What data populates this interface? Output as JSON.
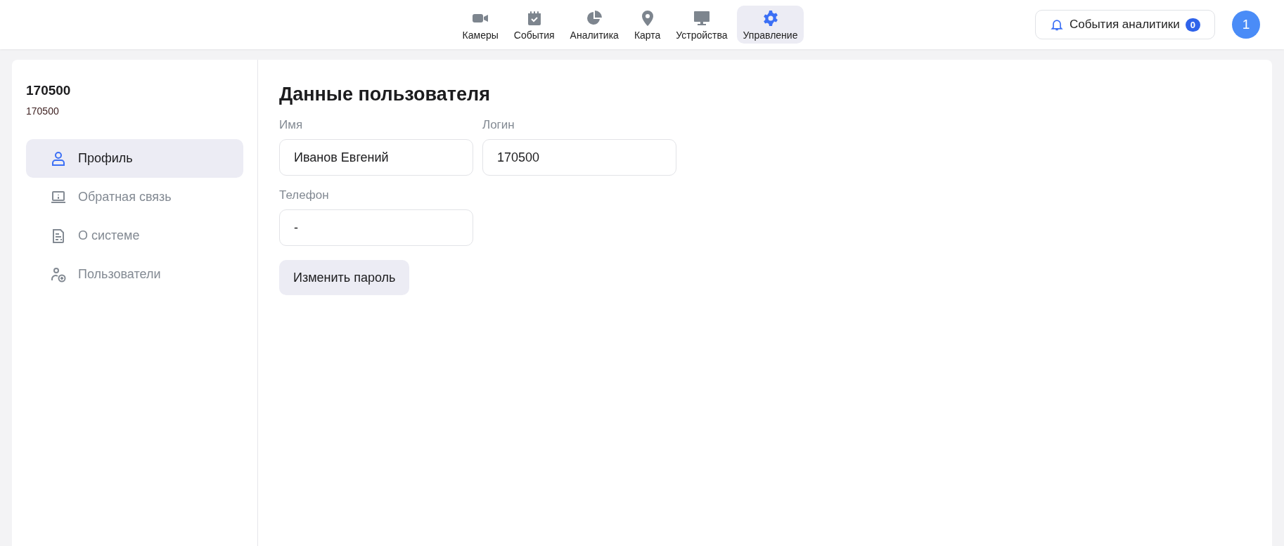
{
  "nav": [
    {
      "label": "Камеры",
      "selected": false
    },
    {
      "label": "События",
      "selected": false
    },
    {
      "label": "Аналитика",
      "selected": false
    },
    {
      "label": "Карта",
      "selected": false
    },
    {
      "label": "Устройства",
      "selected": false
    },
    {
      "label": "Управление",
      "selected": true
    }
  ],
  "events_button": {
    "label": "События аналитики",
    "count": "0"
  },
  "avatar": "1",
  "sidebar": {
    "title": "170500",
    "subtitle": "170500",
    "items": [
      {
        "label": "Профиль",
        "selected": true
      },
      {
        "label": "Обратная связь",
        "selected": false
      },
      {
        "label": "О системе",
        "selected": false
      },
      {
        "label": "Пользователи",
        "selected": false
      }
    ]
  },
  "form": {
    "title": "Данные пользователя",
    "fields": [
      {
        "label": "Имя",
        "value": "Иванов Евгений"
      },
      {
        "label": "Логин",
        "value": "170500"
      },
      {
        "label": "Телефон",
        "value": "-"
      }
    ],
    "button": "Изменить пароль"
  }
}
